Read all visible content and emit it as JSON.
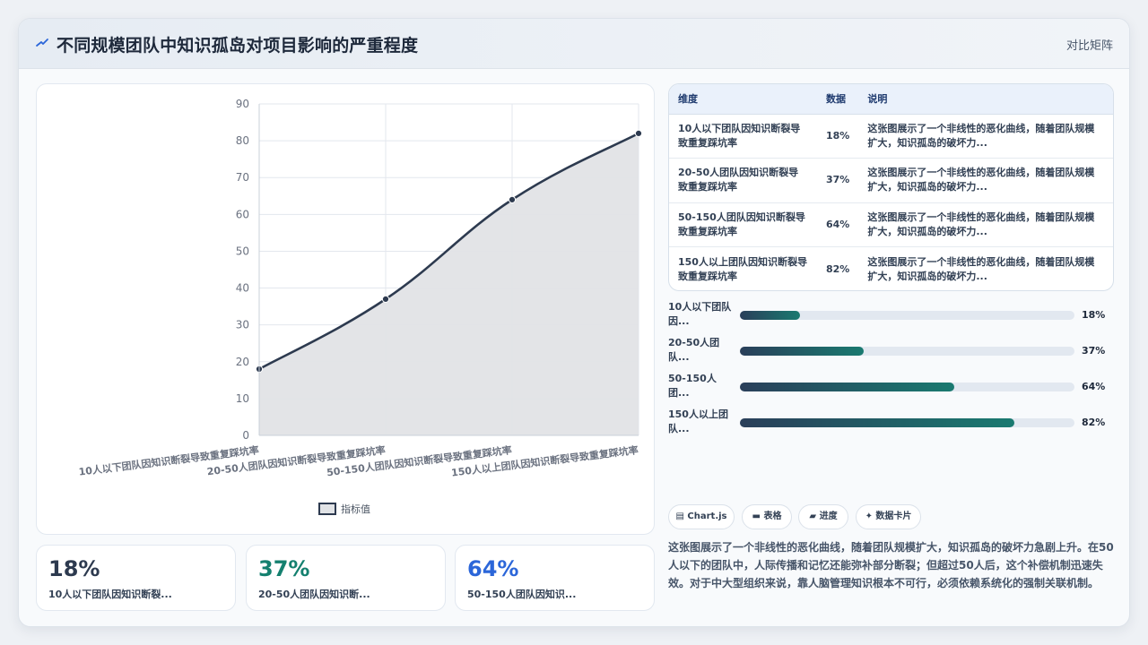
{
  "header": {
    "title": "不同规模团队中知识孤岛对项目影响的严重程度",
    "switch_label": "对比矩阵",
    "icon": "sparkle-icon"
  },
  "chart_data": {
    "type": "area",
    "categories": [
      "10人以下团队因知识断裂导致重复踩坑率",
      "20-50人团队因知识断裂导致重复踩坑率",
      "50-150人团队因知识断裂导致重复踩坑率",
      "150人以上团队因知识断裂导致重复踩坑率"
    ],
    "series": [
      {
        "name": "指标值",
        "values": [
          18,
          37,
          64,
          82
        ]
      }
    ],
    "ylim": [
      0,
      90
    ],
    "yticks": [
      "0",
      "10",
      "20",
      "30",
      "40",
      "50",
      "60",
      "70",
      "80",
      "90"
    ],
    "grid": true,
    "legend": "bottom",
    "colors": {
      "line": "#2d3a4f",
      "fill": "#e1e3e6"
    }
  },
  "stats": [
    {
      "value": "18%",
      "label": "10人以下团队因知识断裂...",
      "color": "#2d3a4f"
    },
    {
      "value": "37%",
      "label": "20-50人团队因知识断...",
      "color": "#14806f"
    },
    {
      "value": "64%",
      "label": "50-150人团队因知识...",
      "color": "#2b66d9"
    }
  ],
  "table": {
    "headers": [
      "维度",
      "数据",
      "说明"
    ],
    "rows": [
      {
        "dim": "10人以下团队因知识断裂导致重复踩坑率",
        "val": "18%",
        "note": "这张图展示了一个非线性的恶化曲线，随着团队规模扩大，知识孤岛的破坏力..."
      },
      {
        "dim": "20-50人团队因知识断裂导致重复踩坑率",
        "val": "37%",
        "note": "这张图展示了一个非线性的恶化曲线，随着团队规模扩大，知识孤岛的破坏力..."
      },
      {
        "dim": "50-150人团队因知识断裂导致重复踩坑率",
        "val": "64%",
        "note": "这张图展示了一个非线性的恶化曲线，随着团队规模扩大，知识孤岛的破坏力..."
      },
      {
        "dim": "150人以上团队因知识断裂导致重复踩坑率",
        "val": "82%",
        "note": "这张图展示了一个非线性的恶化曲线，随着团队规模扩大，知识孤岛的破坏力..."
      }
    ]
  },
  "progress": [
    {
      "label": "10人以下团队因...",
      "value": "18%",
      "fraction": 0.18
    },
    {
      "label": "20-50人团队...",
      "value": "37%",
      "fraction": 0.37
    },
    {
      "label": "50-150人团...",
      "value": "64%",
      "fraction": 0.64
    },
    {
      "label": "150人以上团队...",
      "value": "82%",
      "fraction": 0.82
    }
  ],
  "tags": [
    {
      "label": "▤ Chart.js"
    },
    {
      "label": "▬ 表格"
    },
    {
      "label": "▰ 进度"
    },
    {
      "label": "✦ 数据卡片"
    }
  ],
  "description": "这张图展示了一个非线性的恶化曲线，随着团队规模扩大，知识孤岛的破坏力急剧上升。在50人以下的团队中，人际传播和记忆还能弥补部分断裂；但超过50人后，这个补偿机制迅速失效。对于中大型组织来说，靠人脑管理知识根本不可行，必须依赖系统化的强制关联机制。"
}
